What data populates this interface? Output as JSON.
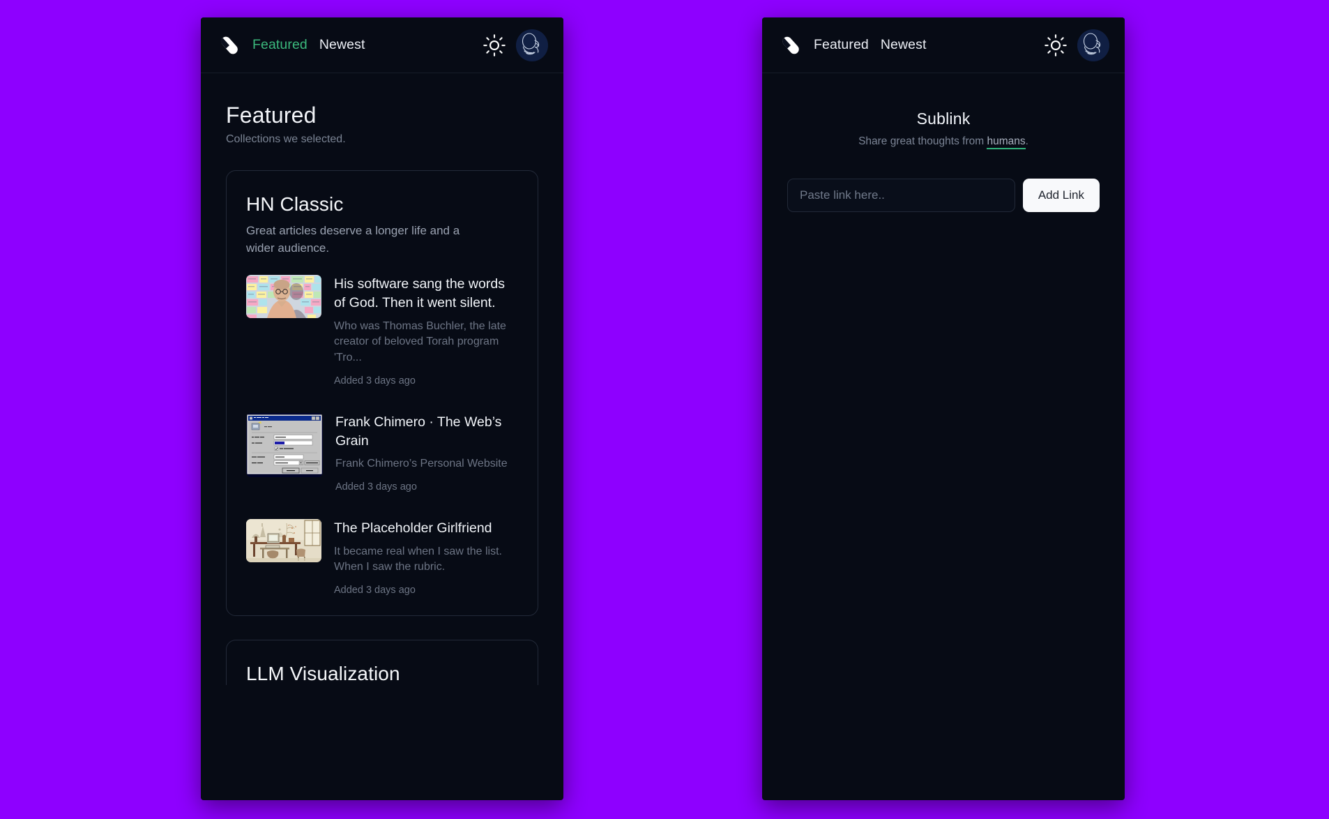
{
  "theme": {
    "page_background": "#8e00ff",
    "panel_background": "#070b15",
    "accent_green": "#3bb87c",
    "text_primary": "#f2f5f9",
    "text_muted": "#6d7585",
    "card_border": "#232a39"
  },
  "header": {
    "logo": "pill-capsule-icon",
    "nav": [
      {
        "label": "Featured",
        "active": true
      },
      {
        "label": "Newest",
        "active": false
      }
    ],
    "theme_toggle_icon": "sun-icon",
    "avatar_icon": "line-art-sketch-avatar"
  },
  "header_right_panel": {
    "nav": [
      {
        "label": "Featured",
        "active": false
      },
      {
        "label": "Newest",
        "active": false
      }
    ]
  },
  "left_panel": {
    "page_title": "Featured",
    "page_subtitle": "Collections we selected.",
    "collections": [
      {
        "title": "HN Classic",
        "description": "Great articles deserve a longer life and a wider audience.",
        "links": [
          {
            "title": "His software sang the words of God. Then it went silent.",
            "description": "Who was Thomas Buchler, the late creator of beloved Torah program 'Tro...",
            "added": "Added 3 days ago",
            "thumbnail": "person-in-front-of-hebrew-sticky-notes"
          },
          {
            "title": "Frank Chimero · The Web’s Grain",
            "description": "Frank Chimero’s Personal Website",
            "added": "Added 3 days ago",
            "thumbnail": "windows95-connect-to-dialog"
          },
          {
            "title": "The Placeholder Girlfriend",
            "description": "It became real when I saw the list. When I saw the rubric.",
            "added": "Added 3 days ago",
            "thumbnail": "sepia-illustration-of-desk-with-computer"
          }
        ]
      },
      {
        "title": "LLM Visualization",
        "description": "",
        "links": []
      }
    ]
  },
  "right_panel": {
    "brand_title": "Sublink",
    "tagline_before": "Share great thoughts from ",
    "tagline_link": "humans",
    "tagline_after": ".",
    "input_placeholder": "Paste link here..",
    "input_value": "",
    "add_button_label": "Add Link"
  },
  "thumbnail_details": {
    "win95_dialog": {
      "titlebar": "Connect To",
      "connection_name": "Skynet",
      "username_label": "User name:",
      "username_value": "username",
      "password_label": "Password:",
      "save_password_label": "Save password",
      "phone_label": "Phone number:",
      "phone_value": "8675309",
      "dialing_label": "Dialing from:",
      "dialing_value": "New Location",
      "dial_properties_label": "Dial Properties...",
      "connect_label": "Connect",
      "cancel_label": "Cancel"
    }
  }
}
